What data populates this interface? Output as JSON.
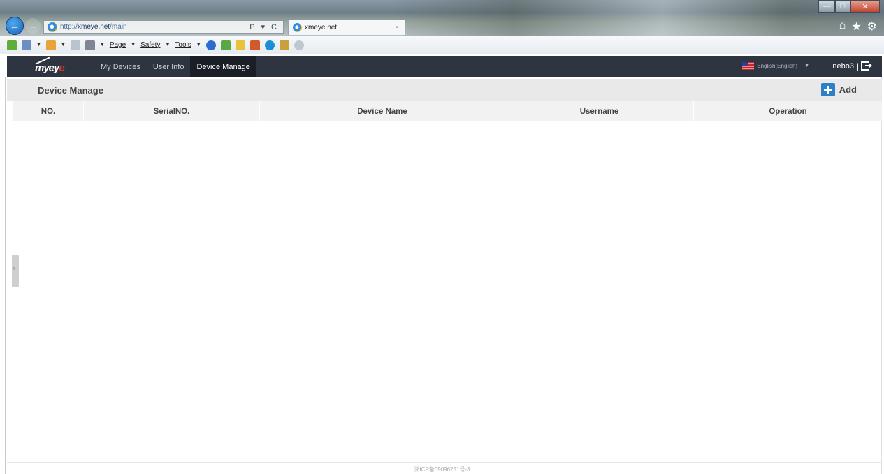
{
  "browser": {
    "url_prefix": "http://",
    "url_host": "xmeye.net",
    "url_path": "/main",
    "address_actions": "P ▾ C",
    "tab_title": "xmeye.net",
    "tab_close": "×",
    "window_controls": {
      "minimize": "—",
      "maximize": "□",
      "close": "✕"
    },
    "chrome_icons": [
      "home-icon",
      "favorites-star-icon",
      "settings-gear-icon"
    ],
    "command_bar": {
      "page_label": "Page",
      "safety_label": "Safety",
      "tools_label": "Tools"
    }
  },
  "app": {
    "logo_text_main": "myey",
    "logo_text_accent": "e",
    "nav": [
      {
        "label": "My Devices",
        "active": false
      },
      {
        "label": "User Info",
        "active": false
      },
      {
        "label": "Device Manage",
        "active": true
      }
    ],
    "language": "English(English)",
    "username": "nebo3",
    "user_separator": "|"
  },
  "page": {
    "title": "Device Manage",
    "add_label": "Add",
    "table": {
      "columns": [
        "NO.",
        "SerialNO.",
        "Device Name",
        "Username",
        "Operation"
      ],
      "rows": []
    },
    "side_handle": "»",
    "footer": "浙ICP备09096251号-3"
  },
  "colors": {
    "header_bg": "#2e3440",
    "active_tab_bg": "#1a1e26",
    "subheader_bg": "#e9e9e9",
    "table_head_bg": "#f2f2f2",
    "accent_blue": "#2b80c7",
    "logo_red": "#e0382f"
  }
}
